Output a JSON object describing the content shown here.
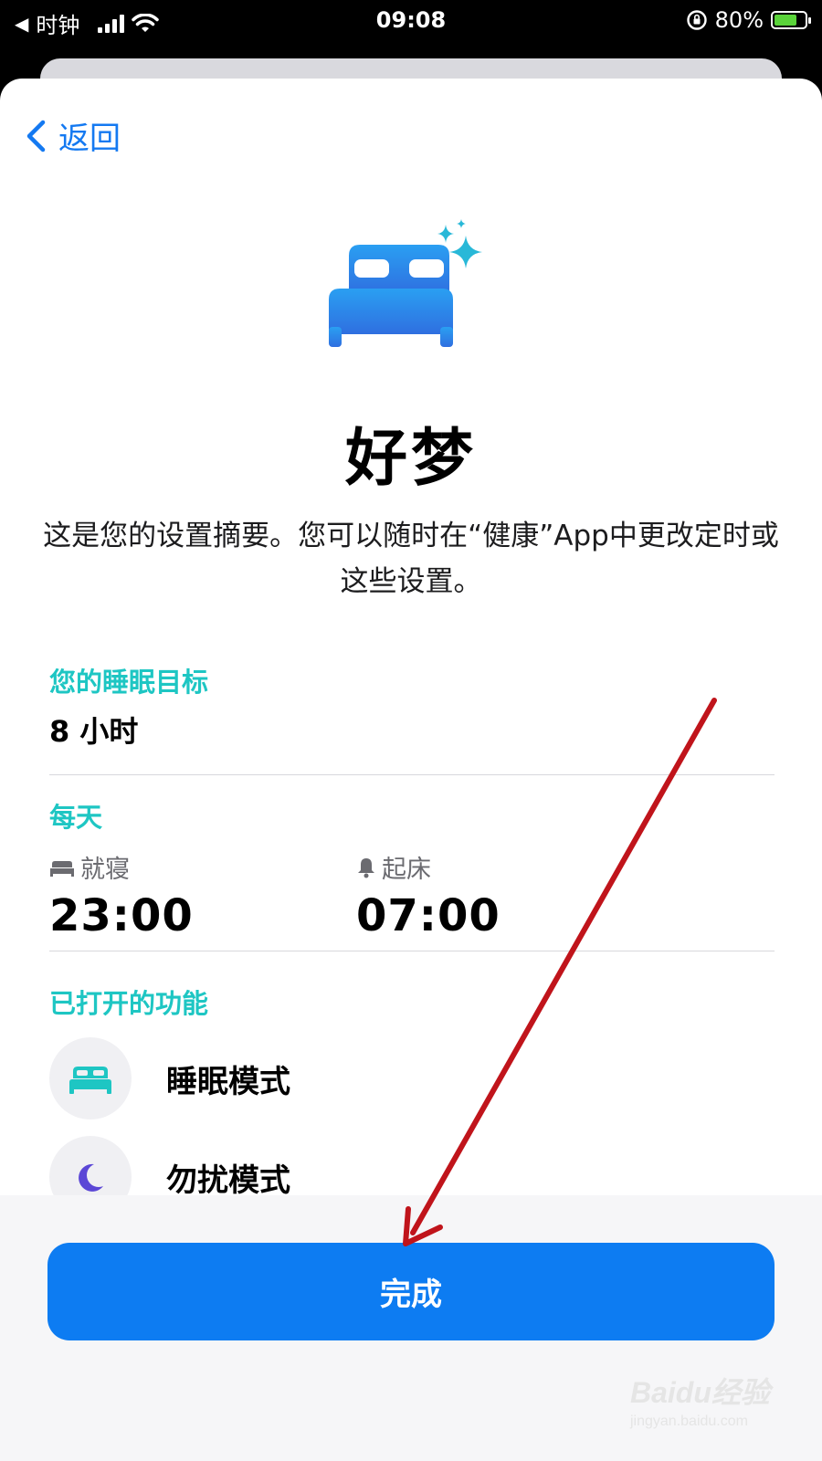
{
  "status_bar": {
    "back_app": "时钟",
    "time": "09:08",
    "battery_percent": "80%",
    "battery_level": 0.8,
    "battery_color": "#5ad43a"
  },
  "nav": {
    "back_label": "返回"
  },
  "hero": {
    "icon": "bed-sparkles-icon",
    "title": "好梦",
    "description": "这是您的设置摘要。您可以随时在“健康”App中更改定时或这些设置。"
  },
  "sleep_goal": {
    "label": "您的睡眠目标",
    "value": "8 小时"
  },
  "schedule": {
    "label": "每天",
    "bedtime": {
      "icon": "bed-icon",
      "label": "就寝",
      "time": "23:00"
    },
    "wakeup": {
      "icon": "bell-icon",
      "label": "起床",
      "time": "07:00"
    }
  },
  "features": {
    "label": "已打开的功能",
    "items": [
      {
        "icon": "bed-icon",
        "label": "睡眠模式"
      },
      {
        "icon": "moon-icon",
        "label": "勿扰模式"
      }
    ]
  },
  "done_button": {
    "label": "完成"
  },
  "watermark": {
    "brand": "Baidu经验",
    "url": "jingyan.baidu.com"
  },
  "colors": {
    "accent_blue": "#0d7cf2",
    "teal": "#1ec6c3",
    "annotation_arrow": "#c0141b"
  }
}
